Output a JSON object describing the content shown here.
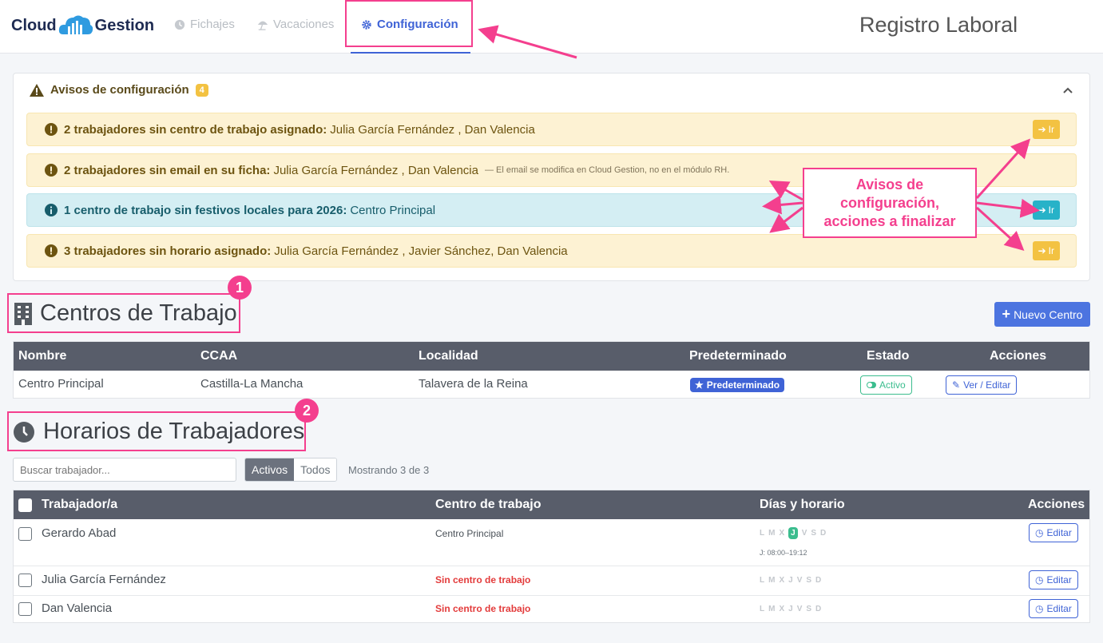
{
  "nav": {
    "logo_left": "Cloud",
    "logo_right": "Gestion",
    "items": [
      {
        "label": "Fichajes",
        "icon": "clock-icon"
      },
      {
        "label": "Vacaciones",
        "icon": "beach-umbrella-icon"
      },
      {
        "label": "Configuración",
        "icon": "gear-icon",
        "active": true
      }
    ],
    "app_title": "Registro Laboral"
  },
  "avisos": {
    "title": "Avisos de configuración",
    "count": "4",
    "items": [
      {
        "type": "warning",
        "bold": "2 trabajadores sin centro de trabajo asignado:",
        "text": "Julia García Fernández , Dan Valencia",
        "note": "",
        "button": "Ir"
      },
      {
        "type": "warning",
        "bold": "2 trabajadores sin email en su ficha:",
        "text": "Julia García Fernández , Dan Valencia",
        "note": "— El email se modifica en Cloud Gestion, no en el módulo RH.",
        "button": ""
      },
      {
        "type": "info",
        "bold": "1 centro de trabajo sin festivos locales para 2026:",
        "text": "Centro Principal",
        "note": "",
        "button": "Ir"
      },
      {
        "type": "warning",
        "bold": "3 trabajadores sin horario asignado:",
        "text": "Julia García Fernández , Javier Sánchez, Dan Valencia",
        "note": "",
        "button": "Ir"
      }
    ]
  },
  "callout": {
    "line1": "Avisos de",
    "line2": "configuración,",
    "line3": "acciones a finalizar"
  },
  "centros": {
    "badge": "1",
    "title": "Centros de Trabajo",
    "new_button": "Nuevo Centro",
    "columns": [
      "Nombre",
      "CCAA",
      "Localidad",
      "Predeterminado",
      "Estado",
      "Acciones"
    ],
    "rows": [
      {
        "nombre": "Centro Principal",
        "ccaa": "Castilla-La Mancha",
        "localidad": "Talavera de la Reina",
        "predeterminado": "Predeterminado",
        "estado": "Activo",
        "accion": "Ver / Editar"
      }
    ]
  },
  "horarios": {
    "badge": "2",
    "title": "Horarios de Trabajadores",
    "search_placeholder": "Buscar trabajador...",
    "filter_active": "Activos",
    "filter_all": "Todos",
    "showing": "Mostrando 3 de 3",
    "columns": [
      "Trabajador/a",
      "Centro de trabajo",
      "Días y horario",
      "Acciones"
    ],
    "days": [
      "L",
      "M",
      "X",
      "J",
      "V",
      "S",
      "D"
    ],
    "rows": [
      {
        "name": "Gerardo Abad",
        "centro": "Centro Principal",
        "active_day": "J",
        "schedule": "J: 08:00–19:12",
        "action": "Editar"
      },
      {
        "name": "Julia García Fernández",
        "centro": "Sin centro de trabajo",
        "active_day": "",
        "schedule": "",
        "action": "Editar"
      },
      {
        "name": "Dan Valencia",
        "centro": "Sin centro de trabajo",
        "active_day": "",
        "schedule": "",
        "action": "Editar"
      }
    ]
  },
  "colors": {
    "primary": "#3f63d6",
    "annotation": "#f43f8e",
    "warning_bg": "#fdf2d3",
    "info_bg": "#d4eef3",
    "table_header": "#585d6a",
    "success": "#3bbd8e",
    "danger": "#e33b3b"
  }
}
